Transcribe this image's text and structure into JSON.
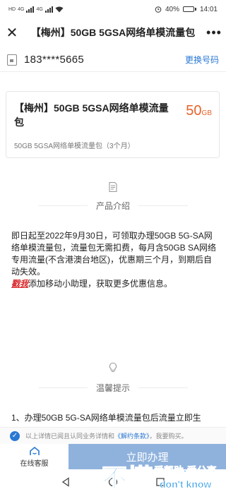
{
  "status_bar": {
    "carrier_tags": [
      "HD",
      "4G",
      "4G"
    ],
    "battery": "40%",
    "battery_level": 0.4,
    "time": "14:01"
  },
  "header": {
    "close_icon": "close-icon",
    "title": "【梅州】50GB 5GSA网络单模流量包",
    "more_icon": "more-icon"
  },
  "phone": {
    "number": "183****5665",
    "change_label": "更换号码"
  },
  "product": {
    "name": "【梅州】50GB 5GSA网络单模流量包",
    "price": "50",
    "price_unit": "GB",
    "desc": "50GB 5GSA网络单模流量包（3个月）"
  },
  "intro_section": {
    "title": "产品介绍",
    "body_before": "即日起至2022年9月30日，可领取办理50GB 5G-SA网络单模流量包，流量包无需扣费，每月含50GB SA网络专用流量(不含港澳台地区)，优惠期三个月，到期后自动失效。",
    "highlight": "戳我",
    "body_after": "添加移动小助理，获取更多优惠信息。"
  },
  "tips_section": {
    "title": "温馨提示",
    "first_line": "1、办理50GB 5G-SA网络单模流量包后流量立即生"
  },
  "agreement": {
    "text_before": "以上详情已阅且认同业务详情和",
    "link": "《解约条款》",
    "text_after": "，我要购买。"
  },
  "bottom": {
    "service_label": "在线客服",
    "order_label": "立即办理"
  },
  "watermark": {
    "main": "不懂",
    "sub1": "爱帮助·爱分享",
    "sub2": "don't know"
  },
  "colors": {
    "accent": "#2a78d4",
    "price": "#e8622a",
    "highlight": "#d8262a",
    "button": "#8fb2dd"
  }
}
